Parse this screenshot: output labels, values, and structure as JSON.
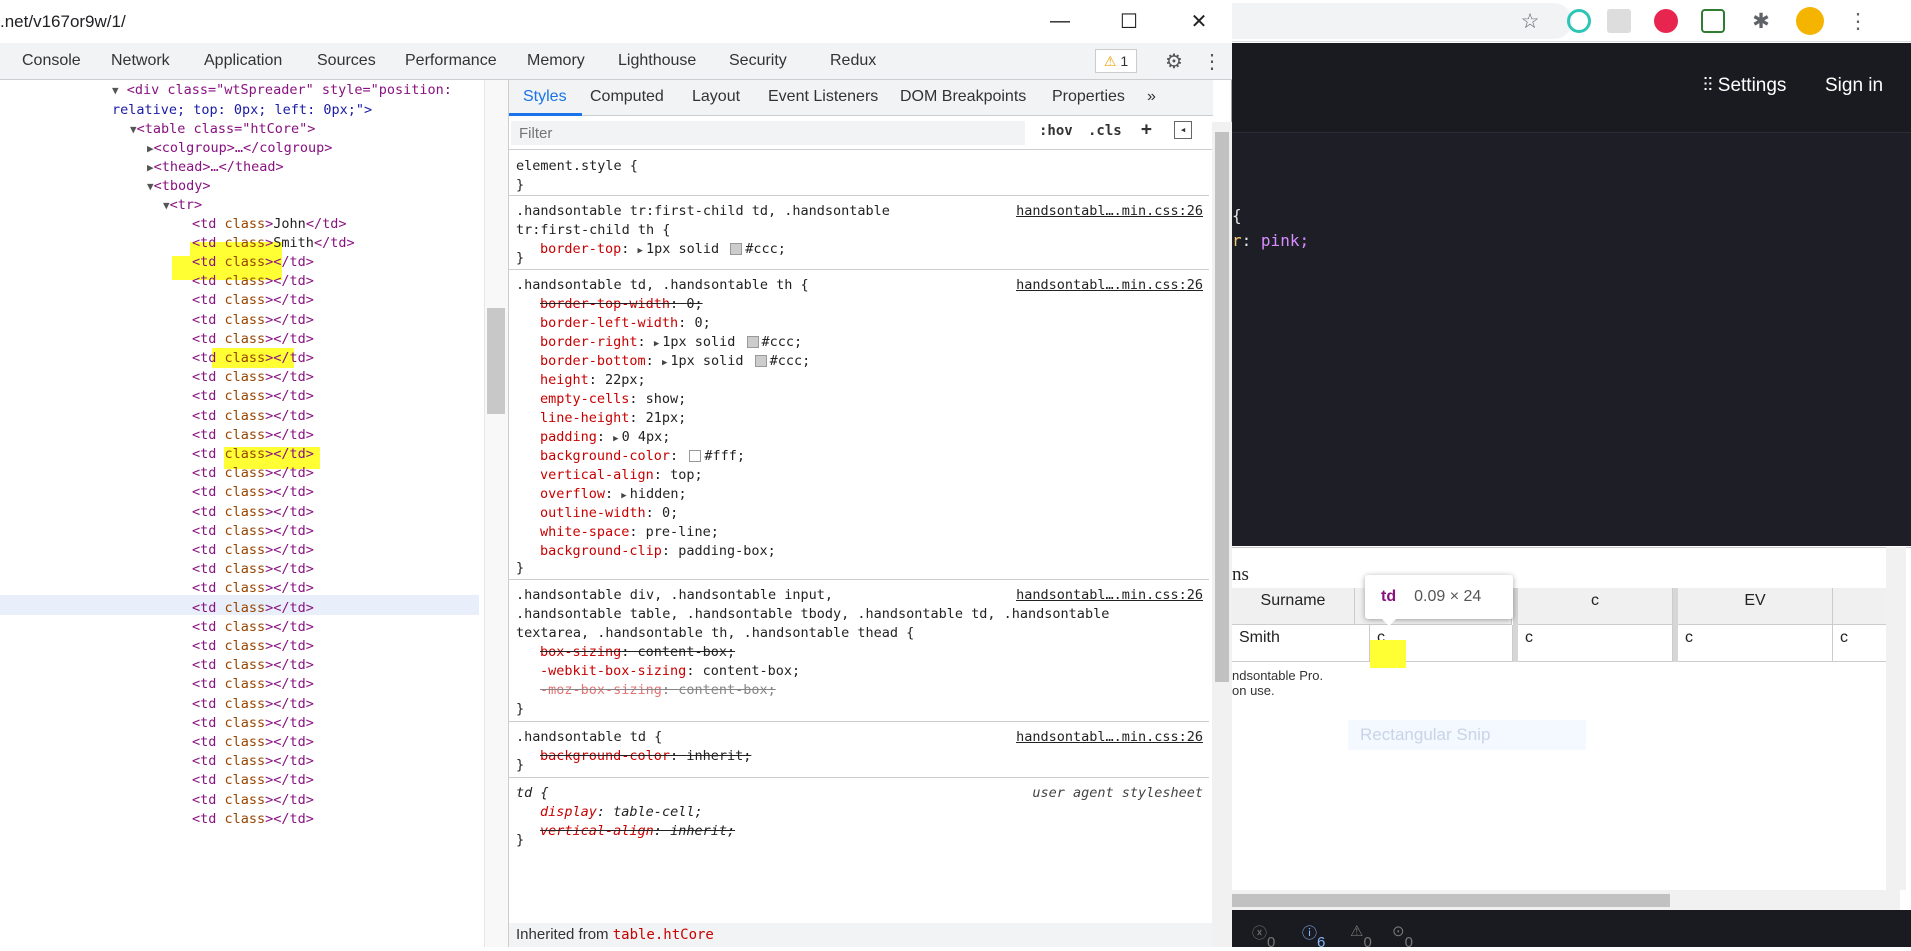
{
  "browser": {
    "settings_label": "Settings",
    "signin_label": "Sign in",
    "code_brace": "{",
    "code_prop": "r",
    "code_colon": ":",
    "code_value": "pink;",
    "result_title": "ns",
    "table_headers": [
      "Surname",
      "c",
      "EV"
    ],
    "table_row": [
      "Smith",
      "c",
      "c",
      "c",
      "c"
    ],
    "tooltip_tag": "td",
    "tooltip_dims": "0.09 × 24",
    "license_lines": [
      "ndsontable Pro.",
      "on use."
    ],
    "snip_ghost": "Rectangular Snip",
    "status_counts": [
      "0",
      "6",
      "0",
      "0"
    ]
  },
  "devtools": {
    "url": ".net/v167or9w/1/",
    "tabs": [
      "Console",
      "Network",
      "Application",
      "Sources",
      "Performance",
      "Memory",
      "Lighthouse",
      "Security",
      "Redux"
    ],
    "warning_count": "1",
    "elements": {
      "spreader_tag": "<div class=\"wtSpreader\" style=\"position:",
      "spreader_cont": "relative; top: 0px; left: 0px;\">",
      "table_line": "<table class=\"htCore\">",
      "colgroup": "<colgroup>…</colgroup>",
      "thead": "<thead>…</thead>",
      "tbody": "<tbody>",
      "tr": "<tr>",
      "td_john": "John",
      "td_smith": "Smith",
      "td_open": "<td ",
      "td_attr": "class",
      "td_close": "></td>"
    },
    "styles": {
      "subtabs": [
        "Styles",
        "Computed",
        "Layout",
        "Event Listeners",
        "DOM Breakpoints",
        "Properties",
        "»"
      ],
      "filter_placeholder": "Filter",
      "hov": ":hov",
      "cls": ".cls",
      "source": "handsontabl….min.css:26",
      "ua_source": "user agent stylesheet",
      "element_style": "element.style {",
      "close_brace": "}",
      "rule1_sel1": ".handsontable tr:first-child td, .handsontable",
      "rule1_sel2": "tr:first-child th {",
      "rule1_p": "border-top",
      "rule1_v": "1px solid",
      "rule1_c": "#ccc;",
      "rule2_sel": ".handsontable td, .handsontable th {",
      "rule2_props": [
        {
          "n": "border-top-width",
          "v": "0;",
          "s": true
        },
        {
          "n": "border-left-width",
          "v": "0;",
          "s": false
        },
        {
          "n": "border-right",
          "v": "1px solid",
          "c": "#ccc;",
          "s": false,
          "x": true
        },
        {
          "n": "border-bottom",
          "v": "1px solid",
          "c": "#ccc;",
          "s": false,
          "x": true
        },
        {
          "n": "height",
          "v": "22px;",
          "s": false
        },
        {
          "n": "empty-cells",
          "v": "show;",
          "s": false
        },
        {
          "n": "line-height",
          "v": "21px;",
          "s": false
        },
        {
          "n": "padding",
          "v": "0 4px;",
          "s": false,
          "x": true
        },
        {
          "n": "background-color",
          "v": "",
          "c": "#fff;",
          "s": false,
          "w": true
        },
        {
          "n": "vertical-align",
          "v": "top;",
          "s": false
        },
        {
          "n": "overflow",
          "v": "hidden;",
          "s": false,
          "x": true
        },
        {
          "n": "outline-width",
          "v": "0;",
          "s": false
        },
        {
          "n": "white-space",
          "v": "pre-line;",
          "s": false
        },
        {
          "n": "background-clip",
          "v": "padding-box;",
          "s": false
        }
      ],
      "rule3_sel1": ".handsontable div, .handsontable input,",
      "rule3_sel2": ".handsontable table, .handsontable tbody, .handsontable td, .handsontable",
      "rule3_sel3": "textarea, .handsontable th, .handsontable thead {",
      "rule3_p1n": "box-sizing",
      "rule3_p1v": "content-box;",
      "rule3_p2n": "-webkit-box-sizing",
      "rule3_p2v": "content-box;",
      "rule3_p3n": "-moz-box-sizing",
      "rule3_p3v": "content-box;",
      "rule4_sel": ".handsontable td {",
      "rule4_pn": "background-color",
      "rule4_pv": "inherit;",
      "rule5_sel": "td {",
      "rule5_p1n": "display",
      "rule5_p1v": "table-cell;",
      "rule5_p2n": "vertical-align",
      "rule5_p2v": "inherit;",
      "inherited_label": "Inherited from",
      "inherited_ref": "table.htCore"
    }
  }
}
